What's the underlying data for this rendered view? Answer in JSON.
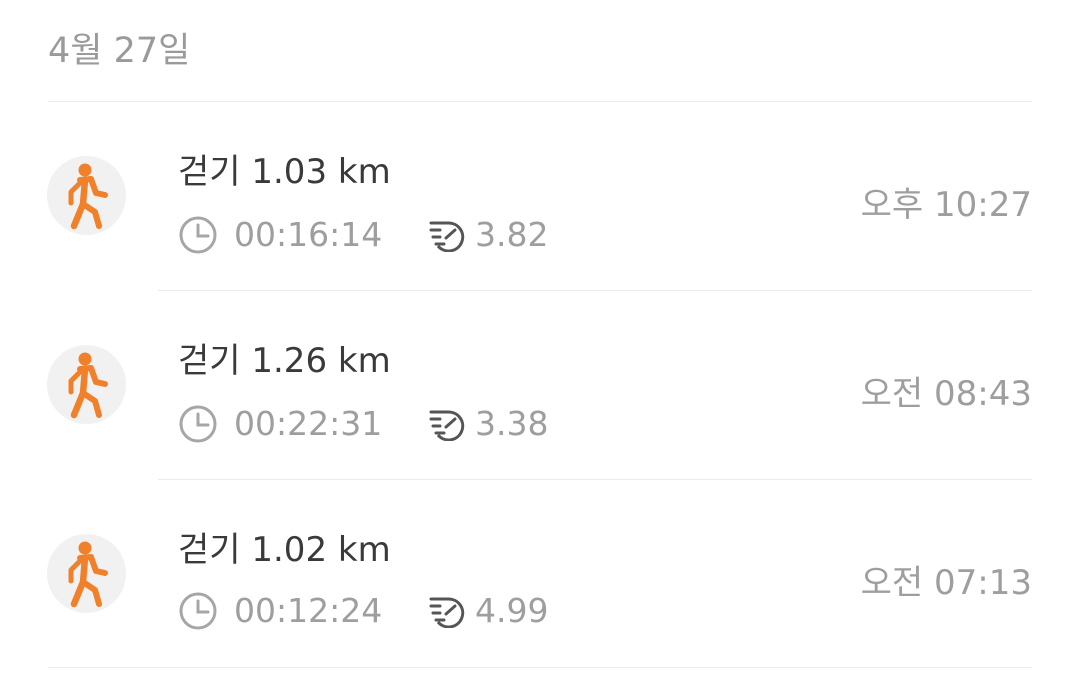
{
  "date_header": "4월 27일",
  "colors": {
    "walk_orange": "#f0802a",
    "avatar_bg": "#f1f1f1"
  },
  "entries": [
    {
      "title": "걷기 1.03 km",
      "duration": "00:16:14",
      "pace": "3.82",
      "time": "오후 10:27",
      "icon": "walking-person-icon"
    },
    {
      "title": "걷기 1.26 km",
      "duration": "00:22:31",
      "pace": "3.38",
      "time": "오전 08:43",
      "icon": "walking-person-icon"
    },
    {
      "title": "걷기 1.02 km",
      "duration": "00:12:24",
      "pace": "4.99",
      "time": "오전 07:13",
      "icon": "walking-person-icon"
    }
  ]
}
